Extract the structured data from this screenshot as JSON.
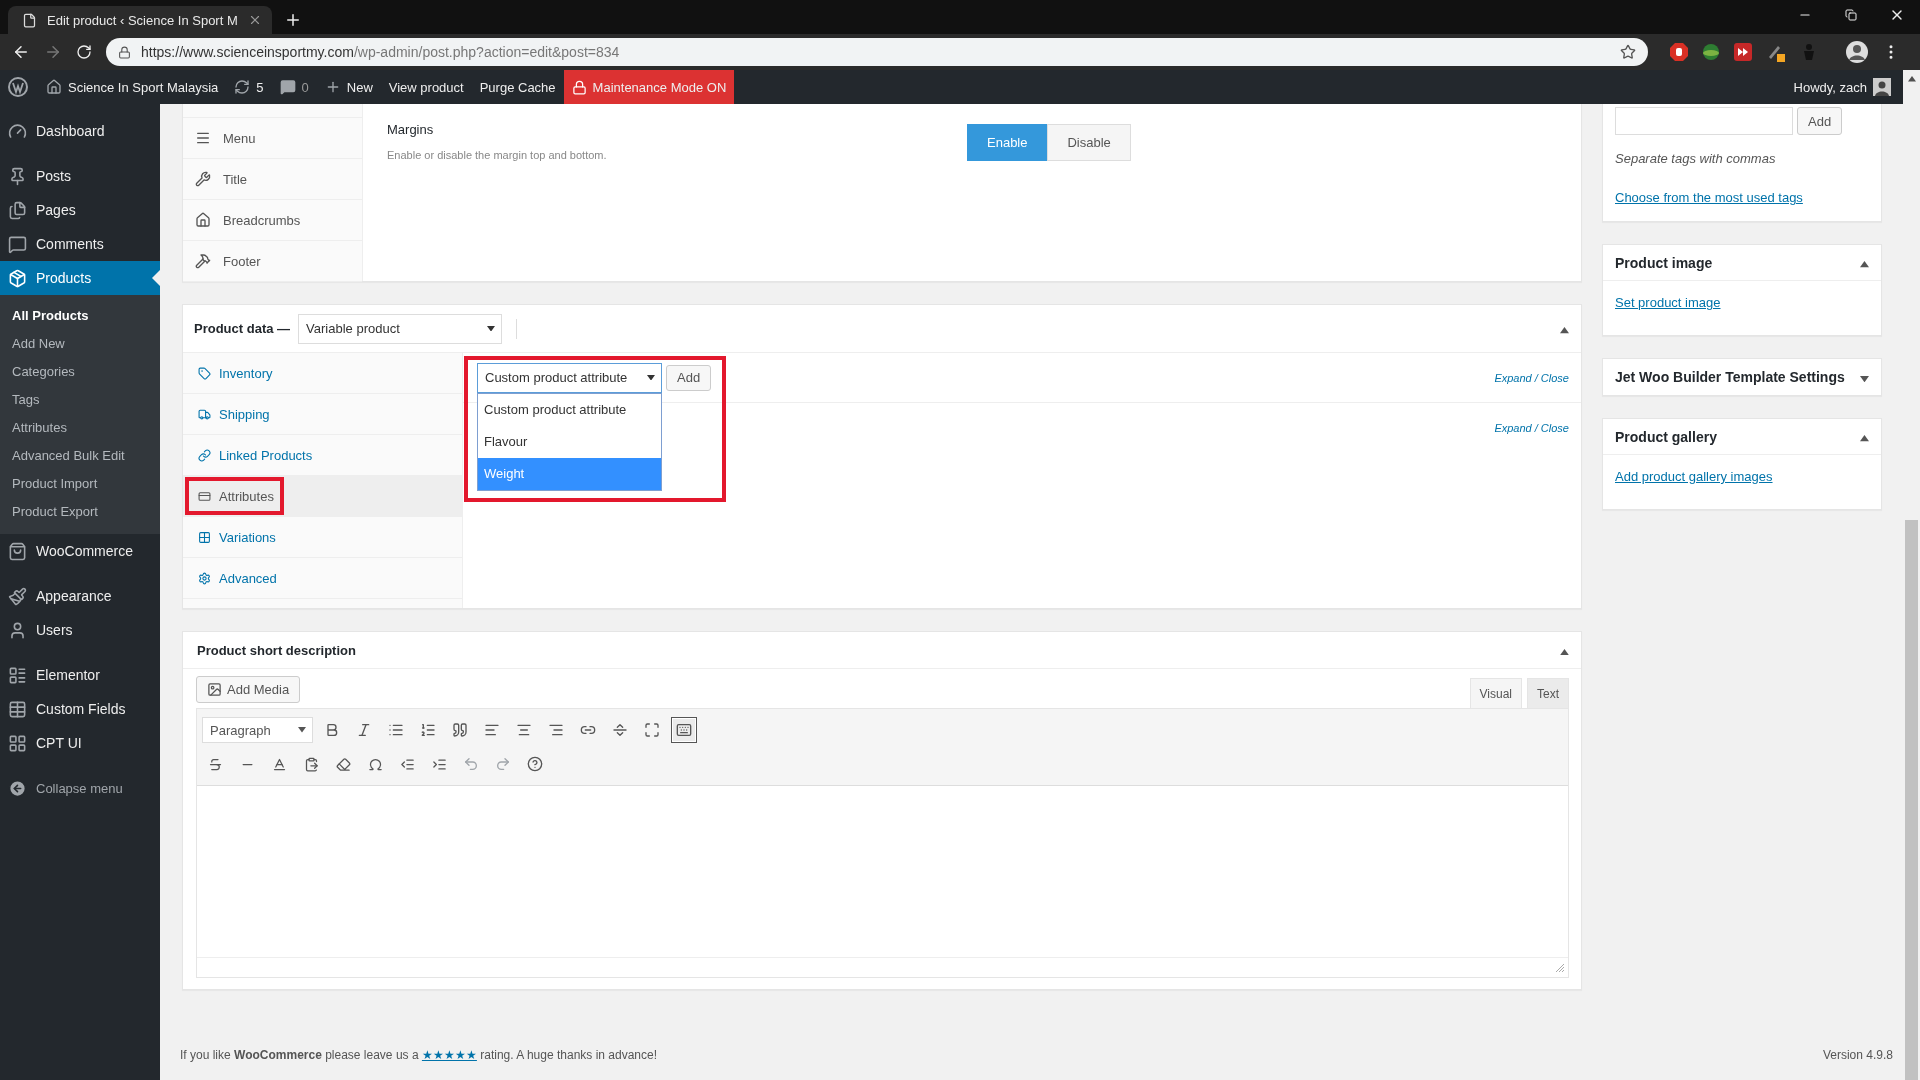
{
  "browser": {
    "tab_title": "Edit product ‹ Science In Sport M",
    "url_host": "https://www.scienceinsportmy.com",
    "url_path": "/wp-admin/post.php?action=edit&post=834"
  },
  "admin_bar": {
    "site_name": "Science In Sport Malaysia",
    "updates": "5",
    "comments": "0",
    "new": "New",
    "links": [
      "View product",
      "Purge Cache"
    ],
    "maintenance": "Maintenance Mode ON",
    "greeting": "Howdy, zach"
  },
  "sidebar": {
    "groups": [
      {
        "items": [
          {
            "label": "Dashboard",
            "selected": false
          }
        ]
      },
      {
        "items": [
          {
            "label": "Posts",
            "selected": false
          },
          {
            "label": "Pages",
            "selected": false
          },
          {
            "label": "Comments",
            "selected": false
          },
          {
            "label": "Products",
            "selected": true,
            "children": [
              {
                "label": "All Products",
                "selected": true
              },
              {
                "label": "Add New",
                "selected": false
              },
              {
                "label": "Categories",
                "selected": false
              },
              {
                "label": "Tags",
                "selected": false
              },
              {
                "label": "Attributes",
                "selected": false
              },
              {
                "label": "Advanced Bulk Edit",
                "selected": false
              },
              {
                "label": "Product Import",
                "selected": false
              },
              {
                "label": "Product Export",
                "selected": false
              }
            ]
          },
          {
            "label": "WooCommerce",
            "selected": false
          }
        ]
      },
      {
        "items": [
          {
            "label": "Appearance",
            "selected": false
          },
          {
            "label": "Users",
            "selected": false
          }
        ]
      },
      {
        "items": [
          {
            "label": "Elementor",
            "selected": false
          },
          {
            "label": "Custom Fields",
            "selected": false
          },
          {
            "label": "CPT UI",
            "selected": false
          }
        ]
      }
    ],
    "collapse": "Collapse menu"
  },
  "theme_options": {
    "tabs": [
      {
        "label": "Menu",
        "selected": false
      },
      {
        "label": "Title",
        "selected": false
      },
      {
        "label": "Breadcrumbs",
        "selected": false
      },
      {
        "label": "Footer",
        "selected": false
      }
    ],
    "setting": {
      "label": "Margins",
      "description": "Enable or disable the margin top and bottom.",
      "options": [
        {
          "label": "Enable",
          "selected": true
        },
        {
          "label": "Disable",
          "selected": false
        }
      ]
    }
  },
  "product_data": {
    "title": "Product data —",
    "type": "Variable product",
    "expanded": true,
    "tabs": [
      {
        "label": "Inventory",
        "selected": false,
        "annotated": false
      },
      {
        "label": "Shipping",
        "selected": false,
        "annotated": false
      },
      {
        "label": "Linked Products",
        "selected": false,
        "annotated": false
      },
      {
        "label": "Attributes",
        "selected": true,
        "annotated": true
      },
      {
        "label": "Variations",
        "selected": false,
        "annotated": false
      },
      {
        "label": "Advanced",
        "selected": false,
        "annotated": false
      }
    ],
    "attribute_select": {
      "value": "Custom product attribute",
      "expanded": true,
      "annotated": true,
      "options": [
        {
          "label": "Custom product attribute",
          "highlighted": false
        },
        {
          "label": "Flavour",
          "highlighted": false
        },
        {
          "label": "Weight",
          "highlighted": true
        }
      ]
    },
    "add_button": "Add",
    "expand_links": [
      "Expand / Close",
      "Expand / Close"
    ]
  },
  "short_description": {
    "title": "Product short description",
    "expanded": true,
    "add_media": "Add Media",
    "editor_tabs": [
      {
        "label": "Visual",
        "selected": true
      },
      {
        "label": "Text",
        "selected": false
      }
    ],
    "format": "Paragraph",
    "toolbar_toggle_pressed": true,
    "undo_disabled": true,
    "redo_disabled": true
  },
  "tags": {
    "add": "Add",
    "hint": "Separate tags with commas",
    "link": "Choose from the most used tags"
  },
  "side_boxes": [
    {
      "title": "Product image",
      "expanded": true,
      "link": "Set product image"
    },
    {
      "title": "Jet Woo Builder Template Settings",
      "expanded": false
    },
    {
      "title": "Product gallery",
      "expanded": true,
      "link": "Add product gallery images"
    }
  ],
  "footer": {
    "text": "If you like **WooCommerce** please leave us a",
    "rating": "★★★★★",
    "after": "rating. A huge thanks in advance!",
    "version": "Version 4.9.8"
  }
}
